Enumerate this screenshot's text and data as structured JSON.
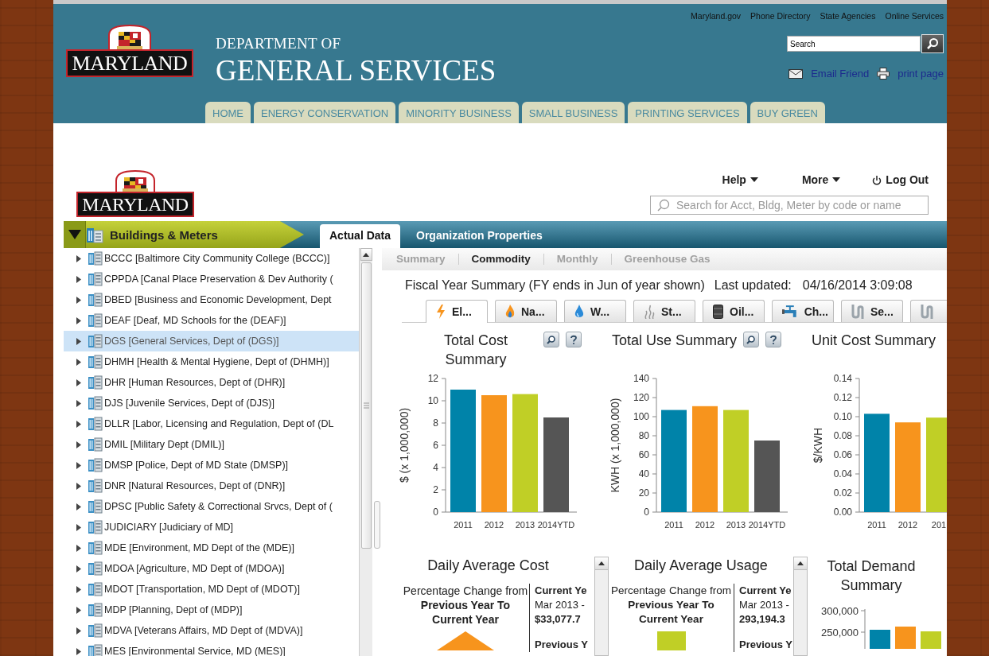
{
  "header": {
    "utility_links": [
      "Maryland.gov",
      "Phone Directory",
      "State Agencies",
      "Online Services"
    ],
    "logo_text": "MARYLAND",
    "title_line_1": "DEPARTMENT OF",
    "title_line_2": "GENERAL SERVICES",
    "search": {
      "value": "Search"
    },
    "share_links": [
      {
        "label": "Email Friend",
        "kind": "email"
      },
      {
        "label": "print page",
        "kind": "print"
      }
    ],
    "nav_tabs": [
      "HOME",
      "ENERGY CONSERVATION",
      "MINORITY BUSINESS",
      "SMALL BUSINESS",
      "PRINTING SERVICES",
      "BUY GREEN"
    ]
  },
  "app": {
    "logo_text": "MARYLAND",
    "menus": [
      {
        "label": "Help",
        "kind": "dropdown"
      },
      {
        "label": "More",
        "kind": "dropdown"
      },
      {
        "label": "Log Out",
        "kind": "logout"
      }
    ],
    "search": {
      "placeholder": "Search for Acct, Bldg, Meter by code or name"
    },
    "section_title": "Buildings & Meters",
    "tabs": [
      {
        "label": "Actual Data",
        "selected": true
      },
      {
        "label": "Organization Properties",
        "selected": false
      }
    ]
  },
  "tree": {
    "items": [
      {
        "label": "BCCC [Baltimore City Community College (BCCC)]",
        "expanded": false,
        "selected": false
      },
      {
        "label": "CPPDA [Canal Place Preservation & Dev Authority (",
        "expanded": false,
        "selected": false
      },
      {
        "label": "DBED [Business and Economic Development, Dept",
        "expanded": false,
        "selected": false
      },
      {
        "label": "DEAF [Deaf, MD Schools for the (DEAF)]",
        "expanded": false,
        "selected": false
      },
      {
        "label": "DGS [General Services, Dept of (DGS)]",
        "expanded": false,
        "selected": true
      },
      {
        "label": "DHMH [Health & Mental Hygiene, Dept of (DHMH)]",
        "expanded": false,
        "selected": false
      },
      {
        "label": "DHR [Human Resources, Dept of (DHR)]",
        "expanded": false,
        "selected": false
      },
      {
        "label": "DJS [Juvenile Services, Dept of (DJS)]",
        "expanded": false,
        "selected": false
      },
      {
        "label": "DLLR [Labor, Licensing and Regulation, Dept of (DL",
        "expanded": false,
        "selected": false
      },
      {
        "label": "DMIL [Military Dept (DMIL)]",
        "expanded": false,
        "selected": false
      },
      {
        "label": "DMSP [Police, Dept of MD State (DMSP)]",
        "expanded": false,
        "selected": false
      },
      {
        "label": "DNR [Natural Resources, Dept of (DNR)]",
        "expanded": false,
        "selected": false
      },
      {
        "label": "DPSC [Public Safety & Correctional Srvcs, Dept of (",
        "expanded": false,
        "selected": false
      },
      {
        "label": "JUDICIARY [Judiciary of MD]",
        "expanded": false,
        "selected": false
      },
      {
        "label": "MDE [Environment, MD Dept of the (MDE)]",
        "expanded": false,
        "selected": false
      },
      {
        "label": "MDOA [Agriculture, MD Dept of (MDOA)]",
        "expanded": false,
        "selected": false
      },
      {
        "label": "MDOT [Transportation, MD Dept of (MDOT)]",
        "expanded": false,
        "selected": false
      },
      {
        "label": "MDP [Planning, Dept of (MDP)]",
        "expanded": false,
        "selected": false
      },
      {
        "label": "MDVA [Veterans Affairs, MD Dept of (MDVA)]",
        "expanded": false,
        "selected": false
      },
      {
        "label": "MES [Environmental Service, MD (MES)]",
        "expanded": false,
        "selected": false
      }
    ]
  },
  "sub_tabs": [
    {
      "label": "Summary",
      "selected": false
    },
    {
      "label": "Commodity",
      "selected": true
    },
    {
      "label": "Monthly",
      "selected": false
    },
    {
      "label": "Greenhouse Gas",
      "selected": false
    }
  ],
  "fiscal_summary": {
    "text": "Fiscal Year Summary (FY ends in Jun of year shown)",
    "updated_label": "Last updated:",
    "updated_value": "04/16/2014 3:09:08"
  },
  "commodity_tabs": [
    {
      "label": "El...",
      "kind": "electric",
      "selected": true
    },
    {
      "label": "Na...",
      "kind": "gas",
      "selected": false
    },
    {
      "label": "W...",
      "kind": "water",
      "selected": false
    },
    {
      "label": "St...",
      "kind": "steam",
      "selected": false
    },
    {
      "label": "Oil...",
      "kind": "oil",
      "selected": false
    },
    {
      "label": "Ch...",
      "kind": "chilled",
      "selected": false
    },
    {
      "label": "Se...",
      "kind": "sewer",
      "selected": false
    },
    {
      "kind": "sewer",
      "selected": false
    }
  ],
  "charts": [
    {
      "title": "Total Cost Summary",
      "tools": true,
      "chart_data": {
        "type": "bar",
        "ylabel": "$ (x 1,000,000)",
        "ylim": [
          0,
          12
        ],
        "yticks": [
          0,
          2,
          4,
          6,
          8,
          10,
          12
        ],
        "series": [
          {
            "name": "2011",
            "color": "#0083a9",
            "values": [
              11.0
            ]
          },
          {
            "name": "2012",
            "color": "#f7941d",
            "values": [
              10.5
            ]
          },
          {
            "name": "2013",
            "color": "#c0cf26",
            "values": [
              10.6
            ]
          },
          {
            "name": "2014YTD",
            "color": "#555555",
            "values": [
              8.5
            ]
          }
        ]
      }
    },
    {
      "title": "Total Use Summary",
      "tools": true,
      "chart_data": {
        "type": "bar",
        "ylabel": "KWH (x 1,000,000)",
        "ylim": [
          0,
          140
        ],
        "yticks": [
          0,
          20,
          40,
          60,
          80,
          100,
          120,
          140
        ],
        "series": [
          {
            "name": "2011",
            "color": "#0083a9",
            "values": [
              107
            ]
          },
          {
            "name": "2012",
            "color": "#f7941d",
            "values": [
              111
            ]
          },
          {
            "name": "2013",
            "color": "#c0cf26",
            "values": [
              107
            ]
          },
          {
            "name": "2014YTD",
            "color": "#555555",
            "values": [
              75
            ]
          }
        ]
      }
    },
    {
      "title": "Unit Cost Summary",
      "tools": false,
      "chart_data": {
        "type": "bar",
        "ylabel": "$/KWH",
        "ylim": [
          0,
          0.14
        ],
        "yticks": [
          {
            "value": 0,
            "label": "0.00"
          },
          {
            "value": 0.02,
            "label": "0.02"
          },
          {
            "value": 0.04,
            "label": "0.04"
          },
          {
            "value": 0.06,
            "label": "0.06"
          },
          {
            "value": 0.08,
            "label": "0.08"
          },
          {
            "value": 0.1,
            "label": "0.10"
          },
          {
            "value": 0.12,
            "label": "0.12"
          },
          {
            "value": 0.14,
            "label": "0.14"
          }
        ],
        "series": [
          {
            "name": "2011",
            "color": "#0083a9",
            "values": [
              0.103
            ]
          },
          {
            "name": "2012",
            "color": "#f7941d",
            "values": [
              0.094
            ]
          },
          {
            "name": "201",
            "color": "#c0cf26",
            "values": [
              0.099
            ]
          }
        ]
      }
    }
  ],
  "daily_panels": [
    {
      "title": "Daily Average Cost",
      "change_label": "Percentage Change from",
      "change_period": "Previous Year To Current Year",
      "current_label": "Current Ye",
      "current_period": "Mar 2013 -",
      "current_value": "$33,077.7",
      "previous_label": "Previous Y",
      "increase": true
    },
    {
      "title": "Daily Average Usage",
      "change_label": "Percentage Change from",
      "change_period": "Previous Year To Current Year",
      "current_label": "Current Ye",
      "current_period": "Mar 2013 -",
      "current_value": "293,194.3",
      "previous_label": "Previous Y",
      "increase": false
    }
  ],
  "demand": {
    "title": "Total Demand Summary",
    "axis_labels": [
      "300,000",
      "250,000"
    ]
  }
}
